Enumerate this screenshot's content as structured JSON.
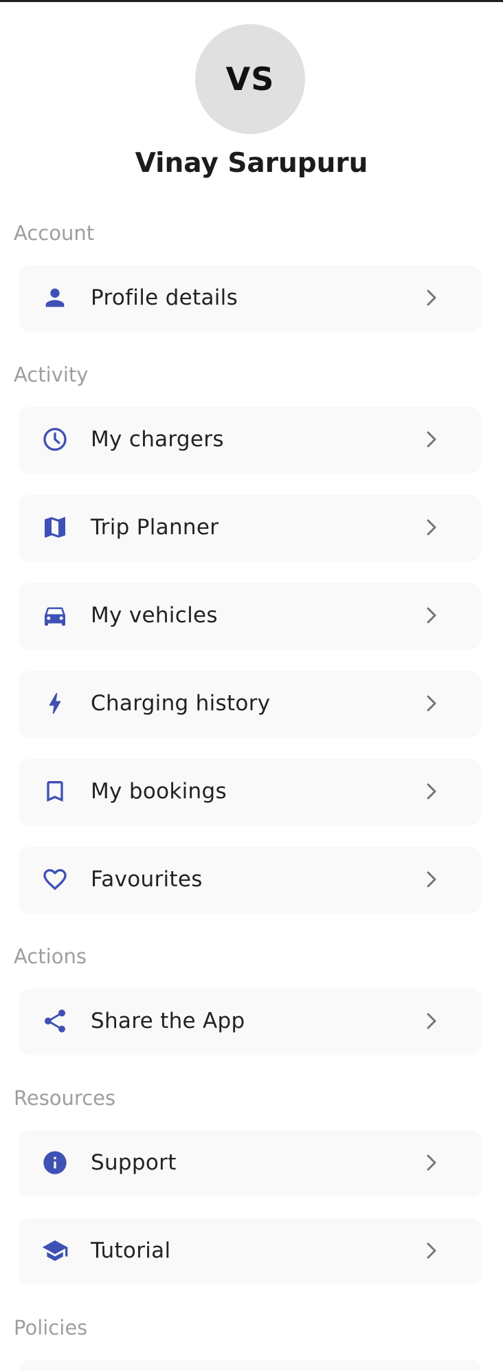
{
  "profile": {
    "initials": "VS",
    "name": "Vinay Sarupuru"
  },
  "colors": {
    "accent": "#3f51b5",
    "section_title": "#9e9e9e",
    "card_bg": "#f9f9f9",
    "avatar_bg": "#e0e0e0"
  },
  "sections": {
    "account": {
      "title": "Account",
      "items": [
        {
          "label": "Profile details",
          "icon": "person-icon"
        }
      ]
    },
    "activity": {
      "title": "Activity",
      "items": [
        {
          "label": "My chargers",
          "icon": "clock-icon"
        },
        {
          "label": "Trip Planner",
          "icon": "map-icon"
        },
        {
          "label": "My vehicles",
          "icon": "car-icon"
        },
        {
          "label": "Charging history",
          "icon": "bolt-icon"
        },
        {
          "label": "My bookings",
          "icon": "bookmark-icon"
        },
        {
          "label": "Favourites",
          "icon": "heart-icon"
        }
      ]
    },
    "actions": {
      "title": "Actions",
      "items": [
        {
          "label": "Share the App",
          "icon": "share-icon"
        }
      ]
    },
    "resources": {
      "title": "Resources",
      "items": [
        {
          "label": "Support",
          "icon": "info-icon"
        },
        {
          "label": "Tutorial",
          "icon": "school-icon"
        }
      ]
    },
    "policies": {
      "title": "Policies"
    }
  }
}
